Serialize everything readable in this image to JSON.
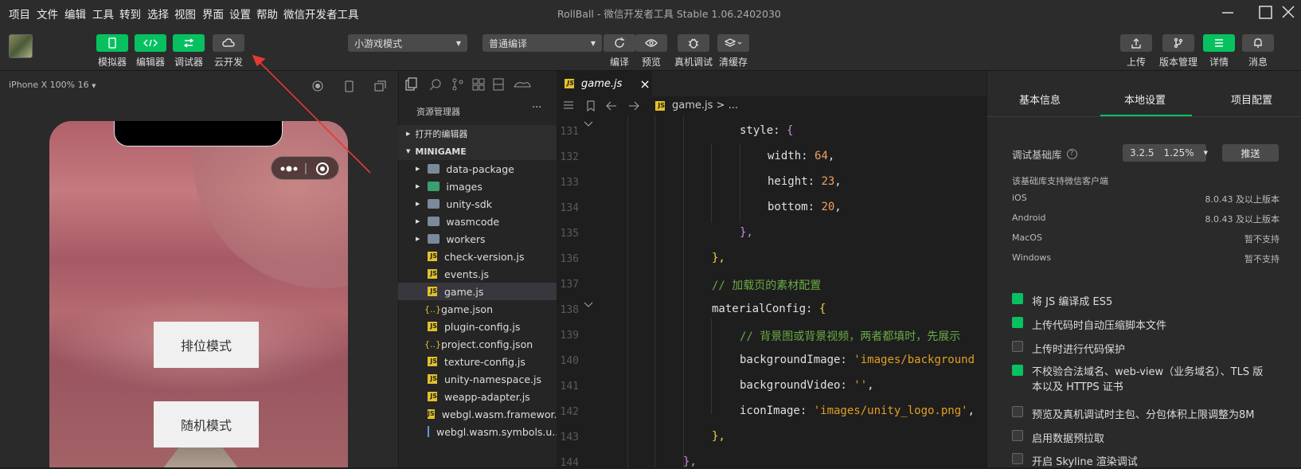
{
  "menubar": {
    "items": [
      "项目",
      "文件",
      "编辑",
      "工具",
      "转到",
      "选择",
      "视图",
      "界面",
      "设置",
      "帮助",
      "微信开发者工具"
    ],
    "title": "RollBall - 微信开发者工具 Stable 1.06.2402030"
  },
  "toolbar": {
    "left_buttons": [
      "模拟器",
      "编辑器",
      "调试器",
      "云开发"
    ],
    "mode_select": "小游戏模式",
    "compile_select": "普通编译",
    "center_buttons": [
      "编译",
      "预览",
      "真机调试",
      "清缓存"
    ],
    "right_buttons": [
      "上传",
      "版本管理",
      "详情",
      "消息"
    ]
  },
  "simulator": {
    "device": "iPhone X 100% 16",
    "button1": "排位模式",
    "button2": "随机模式"
  },
  "explorer": {
    "title": "资源管理器",
    "more": "···",
    "open_editors": "打开的编辑器",
    "root": "MINIGAME",
    "folders": [
      "data-package",
      "images",
      "unity-sdk",
      "wasmcode",
      "workers"
    ],
    "files": [
      "check-version.js",
      "events.js",
      "game.js",
      "game.json",
      "plugin-config.js",
      "project.config.json",
      "texture-config.js",
      "unity-namespace.js",
      "weapp-adapter.js",
      "webgl.wasm.framewor...",
      "webgl.wasm.symbols.u..."
    ]
  },
  "editor": {
    "tab": "game.js",
    "tab_close": "×",
    "breadcrumb_file": "game.js",
    "breadcrumb_rest": "> ...",
    "line_numbers": [
      "131",
      "132",
      "133",
      "134",
      "135",
      "136",
      "137",
      "138",
      "139",
      "140",
      "141",
      "142",
      "143",
      "144"
    ],
    "code": {
      "l131_key": "style: ",
      "l131_brace": "{",
      "l132_key": "width: ",
      "l132_val": "64",
      "l132_end": ",",
      "l133_key": "height: ",
      "l133_val": "23",
      "l133_end": ",",
      "l134_key": "bottom: ",
      "l134_val": "20",
      "l134_end": ",",
      "l135": "},",
      "l136": "},",
      "l137": "// 加载页的素材配置",
      "l138_key": "materialConfig: ",
      "l138_brace": "{",
      "l139": "// 背景图或背景视频，两者都填时，先展示",
      "l140_key": "backgroundImage: ",
      "l140_val": "'images/background",
      "l141_key": "backgroundVideo: ",
      "l141_val": "''",
      "l141_end": ",",
      "l142_key": "iconImage: ",
      "l142_val": "'images/unity_logo.png'",
      "l142_end": ",",
      "l143": "},",
      "l144": "},"
    }
  },
  "rpanel": {
    "tabs": [
      "基本信息",
      "本地设置",
      "项目配置"
    ],
    "lib_label": "调试基础库",
    "lib_version": "3.2.5",
    "lib_percent": "1.25%",
    "push_button": "推送",
    "support_title": "该基础库支持微信客户端",
    "platforms": [
      {
        "name": "iOS",
        "value": "8.0.43 及以上版本"
      },
      {
        "name": "Android",
        "value": "8.0.43 及以上版本"
      },
      {
        "name": "MacOS",
        "value": "暂不支持"
      },
      {
        "name": "Windows",
        "value": "暂不支持"
      }
    ],
    "checks": [
      {
        "label": "将 JS 编译成 ES5",
        "checked": true
      },
      {
        "label": "上传代码时自动压缩脚本文件",
        "checked": true
      },
      {
        "label": "上传时进行代码保护",
        "checked": false
      },
      {
        "label": "不校验合法域名、web-view（业务域名）、TLS 版",
        "label2": "本以及 HTTPS 证书",
        "checked": true
      },
      {
        "label": "预览及真机调试时主包、分包体积上限调整为8M",
        "checked": false
      },
      {
        "label": "启用数据预拉取",
        "checked": false
      },
      {
        "label": "开启 Skyline 渲染调试",
        "checked": false
      }
    ]
  },
  "colors": {
    "accent": "#07c160",
    "annotation_arrow": "#e53935"
  }
}
